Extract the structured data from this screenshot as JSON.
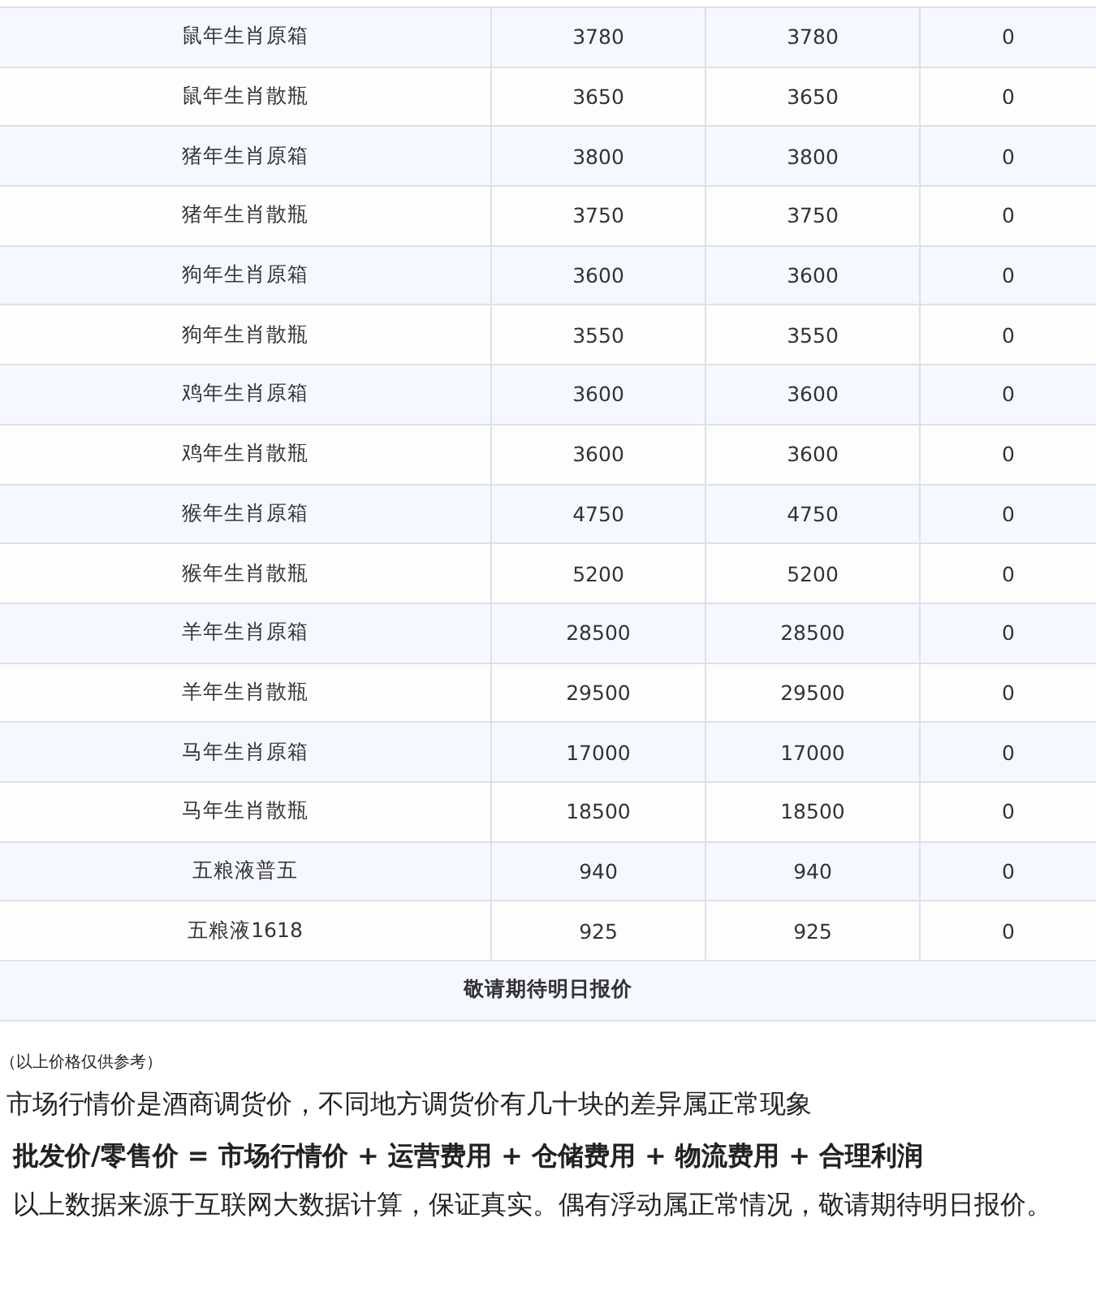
{
  "table": {
    "rows": [
      {
        "cells": [
          "鼠年生肖原箱",
          "3780",
          "3780",
          "0"
        ]
      },
      {
        "cells": [
          "鼠年生肖散瓶",
          "3650",
          "3650",
          "0"
        ]
      },
      {
        "cells": [
          "猪年生肖原箱",
          "3800",
          "3800",
          "0"
        ]
      },
      {
        "cells": [
          "猪年生肖散瓶",
          "3750",
          "3750",
          "0"
        ]
      },
      {
        "cells": [
          "狗年生肖原箱",
          "3600",
          "3600",
          "0"
        ]
      },
      {
        "cells": [
          "狗年生肖散瓶",
          "3550",
          "3550",
          "0"
        ]
      },
      {
        "cells": [
          "鸡年生肖原箱",
          "3600",
          "3600",
          "0"
        ]
      },
      {
        "cells": [
          "鸡年生肖散瓶",
          "3600",
          "3600",
          "0"
        ]
      },
      {
        "cells": [
          "猴年生肖原箱",
          "4750",
          "4750",
          "0"
        ]
      },
      {
        "cells": [
          "猴年生肖散瓶",
          "5200",
          "5200",
          "0"
        ]
      },
      {
        "cells": [
          "羊年生肖原箱",
          "28500",
          "28500",
          "0"
        ]
      },
      {
        "cells": [
          "羊年生肖散瓶",
          "29500",
          "29500",
          "0"
        ]
      },
      {
        "cells": [
          "马年生肖原箱",
          "17000",
          "17000",
          "0"
        ]
      },
      {
        "cells": [
          "马年生肖散瓶",
          "18500",
          "18500",
          "0"
        ]
      },
      {
        "cells": [
          "五粮液普五",
          "940",
          "940",
          "0"
        ]
      },
      {
        "cells": [
          "五粮液1618",
          "925",
          "925",
          "0"
        ]
      }
    ],
    "footer": "敬请期待明日报价"
  },
  "notes": {
    "disclaimer": "（以上价格仅供参考）",
    "market_note": "市场行情价是酒商调货价，不同地方调货价有几十块的差异属正常现象",
    "formula": "批发价/零售价 = 市场行情价 + 运营费用 + 仓储费用 + 物流费用 + 合理利润",
    "source_note": "以上数据来源于互联网大数据计算，保证真实。偶有浮动属正常情况，敬请期待明日报价。"
  }
}
